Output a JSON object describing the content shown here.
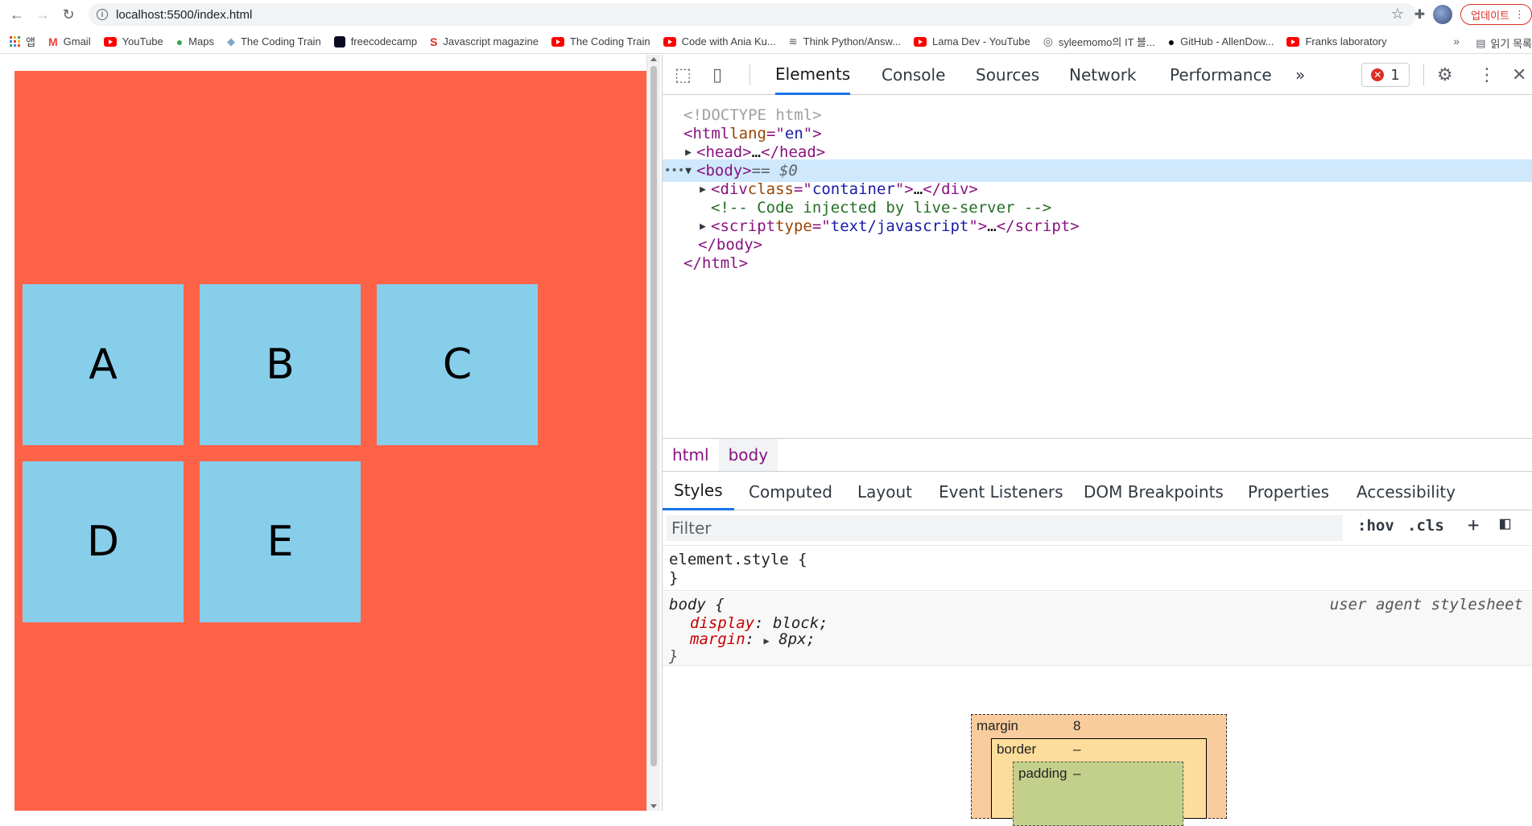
{
  "browser": {
    "url": "localhost:5500/index.html",
    "update_label": "업데이트",
    "bookmarks": [
      {
        "label": "앱",
        "icon": "apps-icon"
      },
      {
        "label": "Gmail",
        "icon": "gmail-icon"
      },
      {
        "label": "YouTube",
        "icon": "youtube-icon"
      },
      {
        "label": "Maps",
        "icon": "maps-icon"
      },
      {
        "label": "The Coding Train",
        "icon": "coding-train-icon"
      },
      {
        "label": "freecodecamp",
        "icon": "freecodecamp-icon"
      },
      {
        "label": "Javascript magazine",
        "icon": "js-magazine-icon"
      },
      {
        "label": "The Coding Train",
        "icon": "youtube-icon"
      },
      {
        "label": "Code with Ania Ku...",
        "icon": "youtube-icon"
      },
      {
        "label": "Think Python/Answ...",
        "icon": "think-python-icon"
      },
      {
        "label": "Lama Dev - YouTube",
        "icon": "youtube-icon"
      },
      {
        "label": "syleemomo의 IT 블...",
        "icon": "globe-icon"
      },
      {
        "label": "GitHub - AllenDow...",
        "icon": "github-icon"
      },
      {
        "label": "Franks laboratory",
        "icon": "youtube-icon"
      }
    ],
    "reading_list_label": "읽기 목록"
  },
  "page": {
    "boxes": [
      "A",
      "B",
      "C",
      "D",
      "E"
    ],
    "colors": {
      "container": "#ff6347",
      "box": "#87ceeb"
    }
  },
  "devtools": {
    "tabs": [
      "Elements",
      "Console",
      "Sources",
      "Network",
      "Performance"
    ],
    "more_tabs": "»",
    "error_count": "1",
    "dom": {
      "doctype": "<!DOCTYPE html>",
      "html_open_tag": "html",
      "lang_attr": "lang",
      "lang_val": "en",
      "head": "head",
      "head_ellipsis": "…",
      "body": "body",
      "body_marker": "== $0",
      "div_tag": "div",
      "div_attr": "class",
      "div_val": "container",
      "ellipsis": "…",
      "comment": "<!-- Code injected by live-server -->",
      "script_tag": "script",
      "script_attr": "type",
      "script_val": "text/javascript"
    },
    "breadcrumbs": [
      "html",
      "body"
    ],
    "sub_tabs": [
      "Styles",
      "Computed",
      "Layout",
      "Event Listeners",
      "DOM Breakpoints",
      "Properties",
      "Accessibility"
    ],
    "filter_placeholder": "Filter",
    "hov": ":hov",
    "cls": ".cls",
    "styles": {
      "element_style": "element.style {",
      "close_brace": "}",
      "body_selector": "body {",
      "user_agent": "user agent stylesheet",
      "display_prop": "display",
      "display_val": "block;",
      "margin_prop": "margin",
      "margin_val": "8px;"
    },
    "box_model": {
      "margin_label": "margin",
      "margin_val": "8",
      "border_label": "border",
      "border_val": "–",
      "padding_label": "padding",
      "padding_val": "–"
    }
  }
}
